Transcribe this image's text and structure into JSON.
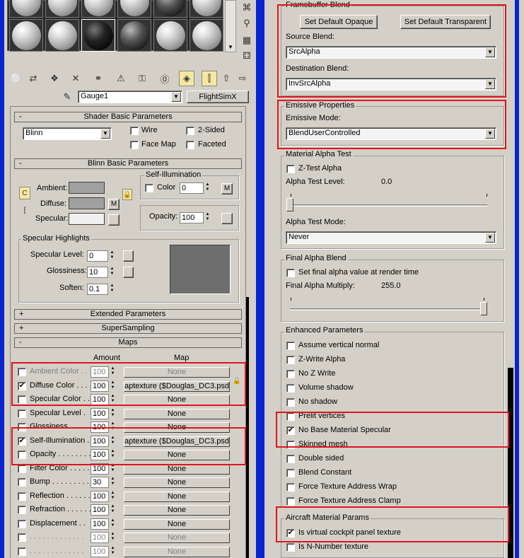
{
  "toolbar": {
    "material_name": "Gauge1",
    "material_type": "FlightSimX"
  },
  "shader_basic": {
    "title": "Shader Basic Parameters",
    "shader": "Blinn",
    "wire": "Wire",
    "two_sided": "2-Sided",
    "face_map": "Face Map",
    "faceted": "Faceted"
  },
  "blinn_basic": {
    "title": "Blinn Basic Parameters",
    "self_illum_title": "Self-Illumination",
    "ambient": "Ambient:",
    "diffuse": "Diffuse:",
    "specular": "Specular:",
    "m": "M",
    "color": "Color",
    "color_value": "0",
    "opacity": "Opacity:",
    "opacity_value": "100",
    "specular_highlights": "Specular Highlights",
    "spec_level": "Specular Level:",
    "spec_level_value": "0",
    "glossiness": "Glossiness:",
    "glossiness_value": "10",
    "soften": "Soften:",
    "soften_value": "0.1"
  },
  "rollouts": {
    "extended": "Extended Parameters",
    "supersampling": "SuperSampling",
    "maps": "Maps"
  },
  "maps": {
    "amount_header": "Amount",
    "map_header": "Map",
    "rows": [
      {
        "label": "Ambient Color . .",
        "amount": "100",
        "map": "None",
        "checked": false,
        "disabled": true
      },
      {
        "label": "Diffuse Color . . . .",
        "amount": "100",
        "map": "aptexture ($Douglas_DC3.psd)",
        "checked": true,
        "disabled": false
      },
      {
        "label": "Specular Color . .",
        "amount": "100",
        "map": "None",
        "checked": false,
        "disabled": false
      },
      {
        "label": "Specular Level .",
        "amount": "100",
        "map": "None",
        "checked": false,
        "disabled": false
      },
      {
        "label": "Glossiness . . . . . .",
        "amount": "100",
        "map": "None",
        "checked": false,
        "disabled": false
      },
      {
        "label": "Self-Illumination .",
        "amount": "100",
        "map": "aptexture ($Douglas_DC3.psd)",
        "checked": true,
        "disabled": false
      },
      {
        "label": "Opacity . . . . . . . .",
        "amount": "100",
        "map": "None",
        "checked": false,
        "disabled": false
      },
      {
        "label": "Filter Color . . . . . .",
        "amount": "100",
        "map": "None",
        "checked": false,
        "disabled": false
      },
      {
        "label": "Bump . . . . . . . . .",
        "amount": "30",
        "map": "None",
        "checked": false,
        "disabled": false
      },
      {
        "label": "Reflection . . . . . .",
        "amount": "100",
        "map": "None",
        "checked": false,
        "disabled": false
      },
      {
        "label": "Refraction . . . . . .",
        "amount": "100",
        "map": "None",
        "checked": false,
        "disabled": false
      },
      {
        "label": "Displacement . .",
        "amount": "100",
        "map": "None",
        "checked": false,
        "disabled": false
      },
      {
        "label": ". . . . . . . . . . . . .",
        "amount": "100",
        "map": "None",
        "checked": false,
        "disabled": true
      },
      {
        "label": ". . . . . . . . . . . . .",
        "amount": "100",
        "map": "None",
        "checked": false,
        "disabled": true
      }
    ]
  },
  "framebuffer": {
    "title": "Framebuffer Blend",
    "btn_opaque": "Set Default Opaque",
    "btn_transparent": "Set Default Transparent",
    "source_label": "Source Blend:",
    "source_value": "SrcAlpha",
    "dest_label": "Destination Blend:",
    "dest_value": "InvSrcAlpha"
  },
  "emissive": {
    "title": "Emissive Properties",
    "mode_label": "Emissive Mode:",
    "mode_value": "BlendUserControlled"
  },
  "alpha_test": {
    "title": "Material Alpha Test",
    "ztest": "Z-Test Alpha",
    "level_label": "Alpha Test Level:",
    "level_value": "0.0",
    "mode_label": "Alpha Test Mode:",
    "mode_value": "Never"
  },
  "final_alpha": {
    "title": "Final Alpha Blend",
    "set_final": "Set final alpha value at render time",
    "multiply_label": "Final Alpha Multiply:",
    "multiply_value": "255.0"
  },
  "enhanced": {
    "title": "Enhanced Parameters",
    "items": [
      {
        "label": "Assume vertical normal",
        "checked": false
      },
      {
        "label": "Z-Write Alpha",
        "checked": false
      },
      {
        "label": "No Z Write",
        "checked": false
      },
      {
        "label": "Volume shadow",
        "checked": false
      },
      {
        "label": "No shadow",
        "checked": false
      },
      {
        "label": "Prelit vertices",
        "checked": false
      },
      {
        "label": "No Base Material Specular",
        "checked": true
      },
      {
        "label": "Skinned mesh",
        "checked": false
      },
      {
        "label": "Double sided",
        "checked": false
      },
      {
        "label": "Blend Constant",
        "checked": false
      },
      {
        "label": "Force Texture Address Wrap",
        "checked": false
      },
      {
        "label": "Force Texture Address Clamp",
        "checked": false
      }
    ]
  },
  "aircraft": {
    "title": "Aircraft Material Params",
    "items": [
      {
        "label": "Is virtual cockpit panel texture",
        "checked": true
      },
      {
        "label": "Is N-Number texture",
        "checked": false
      }
    ]
  },
  "colors": {
    "highlight_red": "#e0141e",
    "frame_blue": "#0a24ce",
    "swatch_gray": "#a0a0a0",
    "preview_gray": "#6e6e6e"
  }
}
